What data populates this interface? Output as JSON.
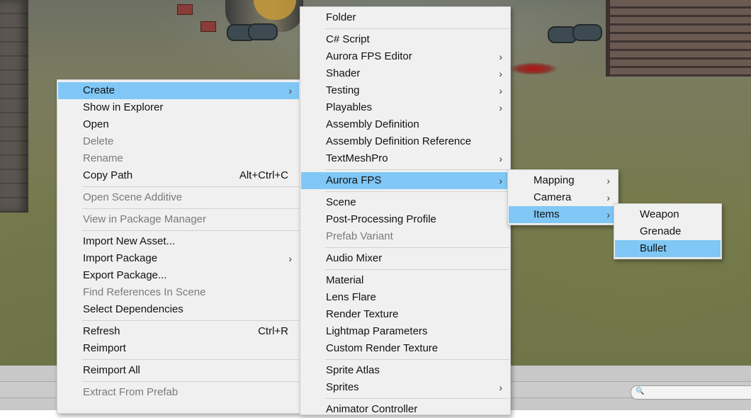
{
  "colors": {
    "menu_bg": "#f0f0f0",
    "highlight": "#80c7f5",
    "disabled_text": "#7a7a7a"
  },
  "icons": {
    "submenu_arrow": "›",
    "search": "🔍"
  },
  "context_menu": {
    "items": [
      {
        "label": "Create",
        "submenu": true,
        "highlighted": true
      },
      {
        "label": "Show in Explorer"
      },
      {
        "label": "Open"
      },
      {
        "label": "Delete",
        "disabled": true
      },
      {
        "label": "Rename",
        "disabled": true
      },
      {
        "label": "Copy Path",
        "shortcut": "Alt+Ctrl+C"
      },
      {
        "label": "Open Scene Additive",
        "disabled": true
      },
      {
        "label": "View in Package Manager",
        "disabled": true
      },
      {
        "label": "Import New Asset..."
      },
      {
        "label": "Import Package",
        "submenu": true
      },
      {
        "label": "Export Package..."
      },
      {
        "label": "Find References In Scene",
        "disabled": true
      },
      {
        "label": "Select Dependencies"
      },
      {
        "label": "Refresh",
        "shortcut": "Ctrl+R"
      },
      {
        "label": "Reimport"
      },
      {
        "label": "Reimport All"
      },
      {
        "label": "Extract From Prefab",
        "disabled": true
      }
    ]
  },
  "create_menu": {
    "items": [
      {
        "label": "Folder"
      },
      {
        "label": "C# Script"
      },
      {
        "label": "Aurora FPS Editor",
        "submenu": true
      },
      {
        "label": "Shader",
        "submenu": true
      },
      {
        "label": "Testing",
        "submenu": true
      },
      {
        "label": "Playables",
        "submenu": true
      },
      {
        "label": "Assembly Definition"
      },
      {
        "label": "Assembly Definition Reference"
      },
      {
        "label": "TextMeshPro",
        "submenu": true
      },
      {
        "label": "Aurora FPS",
        "submenu": true,
        "highlighted": true
      },
      {
        "label": "Scene"
      },
      {
        "label": "Post-Processing Profile"
      },
      {
        "label": "Prefab Variant",
        "disabled": true
      },
      {
        "label": "Audio Mixer"
      },
      {
        "label": "Material"
      },
      {
        "label": "Lens Flare"
      },
      {
        "label": "Render Texture"
      },
      {
        "label": "Lightmap Parameters"
      },
      {
        "label": "Custom Render Texture"
      },
      {
        "label": "Sprite Atlas"
      },
      {
        "label": "Sprites",
        "submenu": true
      },
      {
        "label": "Animator Controller"
      }
    ]
  },
  "aurora_menu": {
    "items": [
      {
        "label": "Mapping",
        "submenu": true
      },
      {
        "label": "Camera",
        "submenu": true
      },
      {
        "label": "Items",
        "submenu": true,
        "highlighted": true
      }
    ]
  },
  "items_menu": {
    "items": [
      {
        "label": "Weapon"
      },
      {
        "label": "Grenade"
      },
      {
        "label": "Bullet",
        "highlighted": true
      }
    ]
  }
}
